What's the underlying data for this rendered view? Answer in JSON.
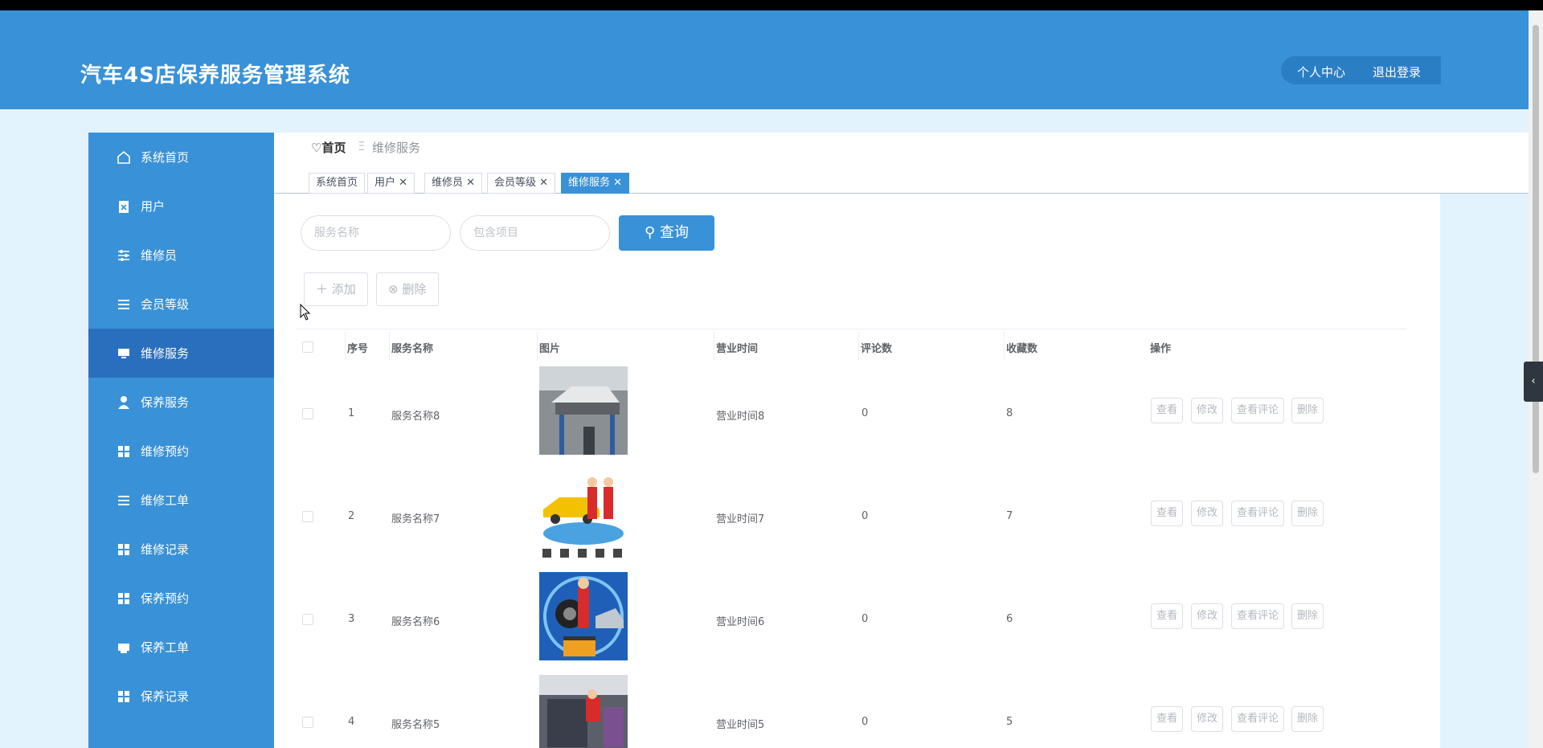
{
  "app": {
    "title": "汽车4S店保养服务管理系统"
  },
  "header": {
    "user_center": "个人中心",
    "logout": "退出登录"
  },
  "sidebar": {
    "items": [
      {
        "label": "系统首页",
        "icon": "home-icon"
      },
      {
        "label": "用户",
        "icon": "clipboard-icon"
      },
      {
        "label": "维修员",
        "icon": "sliders-icon"
      },
      {
        "label": "会员等级",
        "icon": "list-icon"
      },
      {
        "label": "维修服务",
        "icon": "monitor-icon",
        "active": true
      },
      {
        "label": "保养服务",
        "icon": "user-icon"
      },
      {
        "label": "维修预约",
        "icon": "grid-icon"
      },
      {
        "label": "维修工单",
        "icon": "list-icon"
      },
      {
        "label": "维修记录",
        "icon": "grid-icon"
      },
      {
        "label": "保养预约",
        "icon": "grid-icon"
      },
      {
        "label": "保养工单",
        "icon": "printer-icon"
      },
      {
        "label": "保养记录",
        "icon": "grid-icon"
      }
    ]
  },
  "breadcrumb": {
    "home": "首页",
    "separator": "Ξ",
    "current": "维修服务"
  },
  "tabs": [
    {
      "label": "系统首页"
    },
    {
      "label": "用户"
    },
    {
      "label": "维修员"
    },
    {
      "label": "会员等级"
    },
    {
      "label": "维修服务",
      "active": true
    }
  ],
  "search": {
    "name_placeholder": "服务名称",
    "items_placeholder": "包含项目",
    "query_label": "查询"
  },
  "actions": {
    "add_label": "添加",
    "delete_label": "删除"
  },
  "table": {
    "headers": [
      "序号",
      "服务名称",
      "图片",
      "营业时间",
      "评论数",
      "收藏数",
      "操作"
    ],
    "op_labels": {
      "view": "查看",
      "edit": "修改",
      "view_comments": "查看评论",
      "delete": "删除"
    },
    "rows": [
      {
        "index": "1",
        "name": "服务名称8",
        "hours": "营业时间8",
        "comments": "0",
        "favorites": "8"
      },
      {
        "index": "2",
        "name": "服务名称7",
        "hours": "营业时间7",
        "comments": "0",
        "favorites": "7"
      },
      {
        "index": "3",
        "name": "服务名称6",
        "hours": "营业时间6",
        "comments": "0",
        "favorites": "6"
      },
      {
        "index": "4",
        "name": "服务名称5",
        "hours": "营业时间5",
        "comments": "0",
        "favorites": "5"
      }
    ]
  },
  "colors": {
    "primary": "#3991d7",
    "active_menu": "#2a6fbd",
    "page_bg": "#e3f3fd"
  }
}
